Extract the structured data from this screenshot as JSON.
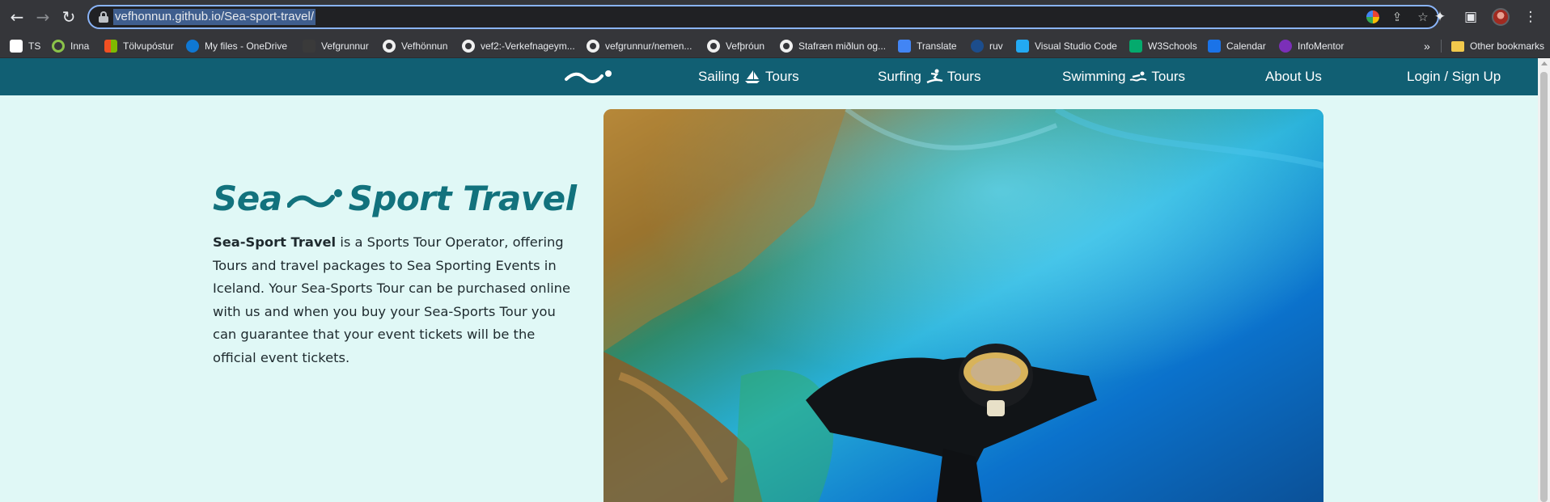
{
  "browser": {
    "url": "vefhonnun.github.io/Sea-sport-travel/",
    "icons": [
      "back-icon",
      "forward-icon",
      "reload-icon",
      "lock-icon",
      "google-icon",
      "share-icon",
      "star-icon",
      "extensions-icon",
      "sidepanel-icon",
      "profile-icon",
      "menu-icon"
    ]
  },
  "bookmarks": {
    "items": [
      {
        "label": "TS",
        "color": "#ffffff"
      },
      {
        "label": "Inna",
        "color": "#8bc34a"
      },
      {
        "label": "Tölvupóstur",
        "color": "#f25022"
      },
      {
        "label": "My files - OneDrive",
        "color": "#0f78d4"
      },
      {
        "label": "Vefgrunnur",
        "color": "#4a4a4a"
      },
      {
        "label": "Vefhönnun",
        "color": "github"
      },
      {
        "label": "vef2:-Verkefnageym...",
        "color": "github"
      },
      {
        "label": "vefgrunnur/nemen...",
        "color": "github"
      },
      {
        "label": "Vefþróun",
        "color": "github"
      },
      {
        "label": "Stafræn miðlun og...",
        "color": "github"
      },
      {
        "label": "Translate",
        "color": "#4285f4"
      },
      {
        "label": "ruv",
        "color": "#1c4d8c"
      },
      {
        "label": "Visual Studio Code",
        "color": "#23a9f2"
      },
      {
        "label": "W3Schools",
        "color": "#04aa6d"
      },
      {
        "label": "Calendar",
        "color": "#1a73e8"
      },
      {
        "label": "InfoMentor",
        "color": "#7b2fb8"
      }
    ],
    "more": "»",
    "other": "Other bookmarks"
  },
  "site": {
    "nav": {
      "logo": "sea-sport-wave-logo",
      "links": [
        {
          "label": "Sailing",
          "suffix": "Tours",
          "icon": "sailboat-icon"
        },
        {
          "label": "Surfing",
          "suffix": "Tours",
          "icon": "surfer-icon"
        },
        {
          "label": "Swimming",
          "suffix": "Tours",
          "icon": "swimmer-icon"
        },
        {
          "label": "About Us"
        },
        {
          "label": "Login / Sign Up"
        }
      ]
    },
    "hero": {
      "title_left": "Sea",
      "title_right": "Sport Travel",
      "brand": "Sea-Sport Travel",
      "description": " is a Sports Tour Operator, offering Tours and travel packages to Sea Sporting Events in Iceland. Your Sea-Sports Tour can be purchased online with us and when you buy your Sea-Sports Tour you can guarantee that your event tickets will be the official event tickets.",
      "image": "underwater-snorkeler-photo"
    },
    "colors": {
      "nav": "#115f73",
      "background": "#e0f8f6",
      "title": "#12727d"
    }
  }
}
